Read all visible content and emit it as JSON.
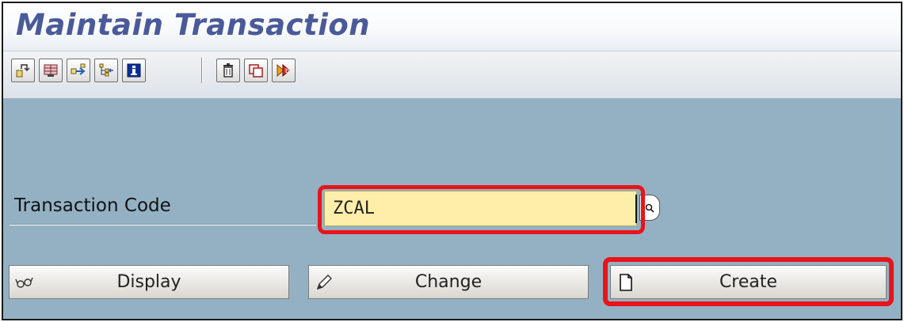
{
  "window": {
    "title": "Maintain Transaction"
  },
  "toolbar": {
    "buttons": [
      {
        "icon": "other-object-icon"
      },
      {
        "icon": "create-list-icon"
      },
      {
        "icon": "transfer-icon"
      },
      {
        "icon": "hierarchy-icon"
      },
      {
        "icon": "information-icon"
      },
      {
        "icon": "delete-icon"
      },
      {
        "icon": "copy-icon"
      },
      {
        "icon": "rename-icon"
      }
    ]
  },
  "form": {
    "transaction_code_label": "Transaction Code",
    "transaction_code_value": "ZCAL"
  },
  "actions": {
    "display_label": "Display",
    "change_label": "Change",
    "create_label": "Create"
  },
  "colors": {
    "screen_background": "#94b1c4",
    "title_text": "#4a5a99",
    "input_background": "#fdeeaa",
    "highlight": "#e8141b"
  }
}
